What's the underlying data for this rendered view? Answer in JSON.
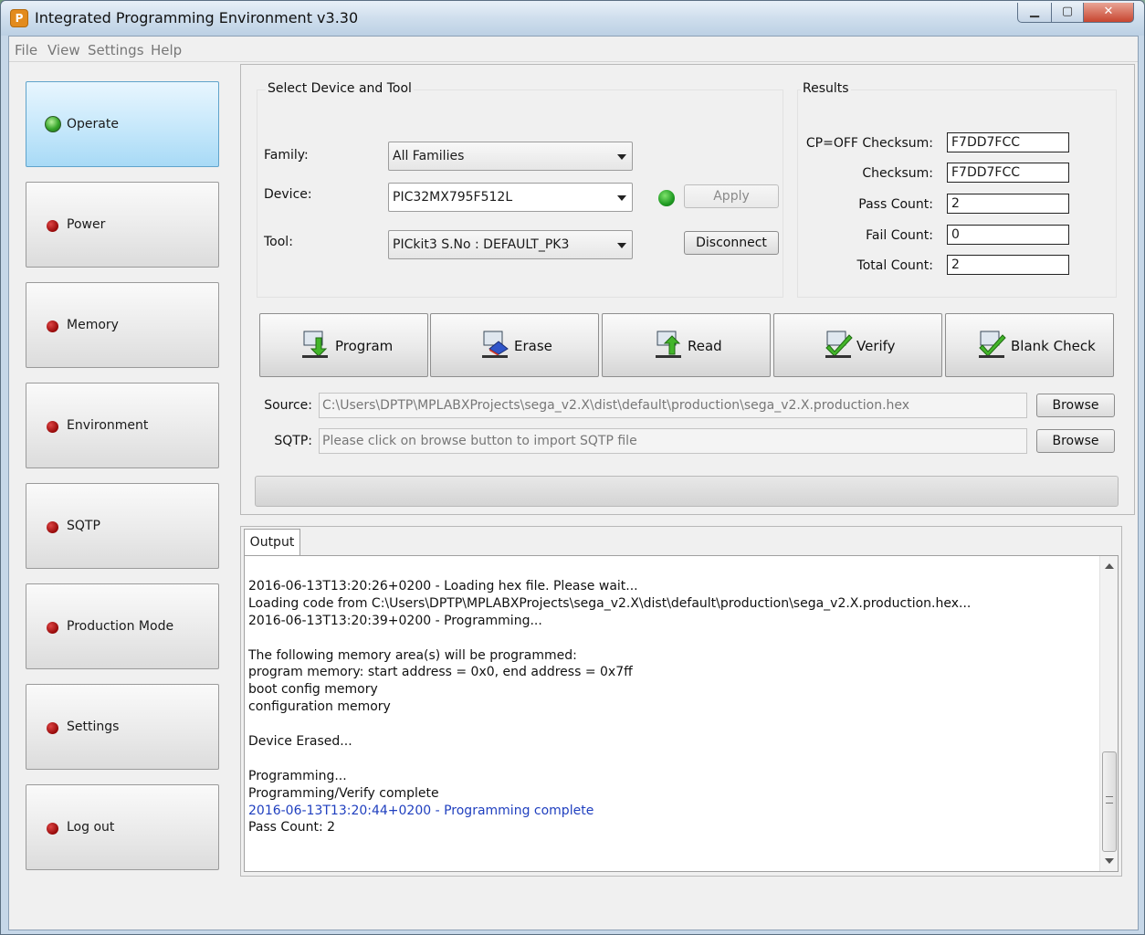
{
  "window": {
    "title": "Integrated Programming Environment v3.30",
    "app_icon_glyph": "P",
    "controls": {
      "minimize": "▁",
      "maximize": "▢",
      "close": "✕"
    }
  },
  "menu": [
    "File",
    "View",
    "Settings",
    "Help"
  ],
  "nav": [
    {
      "label": "Operate",
      "active": true,
      "status": "green"
    },
    {
      "label": "Power",
      "active": false,
      "status": "red"
    },
    {
      "label": "Memory",
      "active": false,
      "status": "red"
    },
    {
      "label": "Environment",
      "active": false,
      "status": "red"
    },
    {
      "label": "SQTP",
      "active": false,
      "status": "red"
    },
    {
      "label": "Production Mode",
      "active": false,
      "status": "red"
    },
    {
      "label": "Settings",
      "active": false,
      "status": "red"
    },
    {
      "label": "Log out",
      "active": false,
      "status": "red"
    }
  ],
  "device_group": {
    "title": "Select Device and Tool",
    "family_label": "Family:",
    "family_value": "All Families",
    "device_label": "Device:",
    "device_value": "PIC32MX795F512L",
    "tool_label": "Tool:",
    "tool_value": "PICkit3 S.No : DEFAULT_PK3",
    "apply_label": "Apply",
    "disconnect_label": "Disconnect",
    "status_color": "#1f9a22"
  },
  "results": {
    "title": "Results",
    "cp_off_checksum_label": "CP=OFF Checksum:",
    "cp_off_checksum_value": "F7DD7FCC",
    "checksum_label": "Checksum:",
    "checksum_value": "F7DD7FCC",
    "pass_count_label": "Pass Count:",
    "pass_count_value": "2",
    "fail_count_label": "Fail Count:",
    "fail_count_value": "0",
    "total_count_label": "Total Count:",
    "total_count_value": "2"
  },
  "actions": {
    "program": "Program",
    "erase": "Erase",
    "read": "Read",
    "verify": "Verify",
    "blank_check": "Blank Check"
  },
  "files": {
    "source_label": "Source:",
    "source_value": "C:\\Users\\DPTP\\MPLABXProjects\\sega_v2.X\\dist\\default\\production\\sega_v2.X.production.hex",
    "sqtp_label": "SQTP:",
    "sqtp_placeholder": "Please click on browse button to import SQTP file",
    "browse_label": "Browse"
  },
  "progress": {
    "fraction": 0.0
  },
  "output": {
    "tab_label": "Output",
    "lines": [
      {
        "text": "2016-06-13T13:20:26+0200 - Loading hex file. Please wait...",
        "highlight": false
      },
      {
        "text": "Loading code from C:\\Users\\DPTP\\MPLABXProjects\\sega_v2.X\\dist\\default\\production\\sega_v2.X.production.hex...",
        "highlight": false
      },
      {
        "text": "2016-06-13T13:20:39+0200 - Programming...",
        "highlight": false
      },
      {
        "text": "",
        "highlight": false
      },
      {
        "text": "The following memory area(s) will be programmed:",
        "highlight": false
      },
      {
        "text": "program memory: start address = 0x0, end address = 0x7ff",
        "highlight": false
      },
      {
        "text": "boot config memory",
        "highlight": false
      },
      {
        "text": "configuration memory",
        "highlight": false
      },
      {
        "text": "",
        "highlight": false
      },
      {
        "text": "Device Erased...",
        "highlight": false
      },
      {
        "text": "",
        "highlight": false
      },
      {
        "text": "Programming...",
        "highlight": false
      },
      {
        "text": "Programming/Verify complete",
        "highlight": false
      },
      {
        "text": "2016-06-13T13:20:44+0200 - Programming complete",
        "highlight": true
      },
      {
        "text": "Pass Count: 2",
        "highlight": false
      }
    ]
  }
}
